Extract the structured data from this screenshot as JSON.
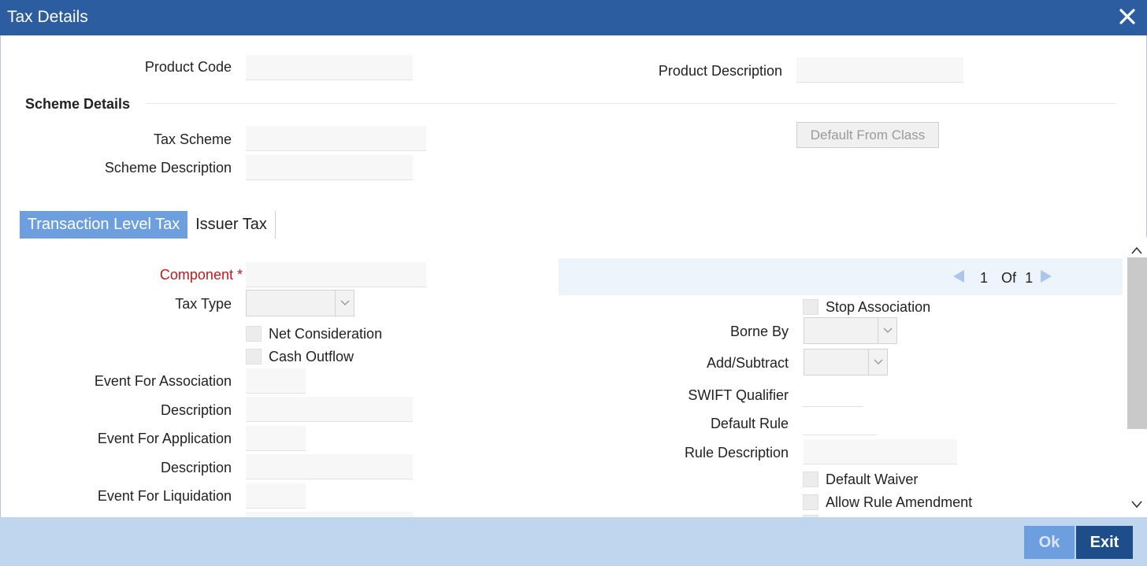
{
  "window": {
    "title": "Tax Details",
    "close_icon": "close-icon"
  },
  "header": {
    "product_code_label": "Product Code",
    "product_code_value": "",
    "product_description_label": "Product Description",
    "product_description_value": ""
  },
  "scheme": {
    "section_title": "Scheme Details",
    "tax_scheme_label": "Tax Scheme",
    "tax_scheme_value": "",
    "scheme_description_label": "Scheme Description",
    "scheme_description_value": "",
    "default_from_class_label": "Default From Class"
  },
  "tabs": [
    {
      "label": "Transaction Level Tax",
      "active": true
    },
    {
      "label": "Issuer Tax",
      "active": false
    }
  ],
  "left_form": {
    "component_label": "Component",
    "required_marker": "*",
    "tax_type_label": "Tax Type",
    "net_consideration_label": "Net Consideration",
    "cash_outflow_label": "Cash Outflow",
    "event_for_association_label": "Event For Association",
    "description_label": "Description",
    "event_for_application_label": "Event For Application",
    "event_for_liquidation_label": "Event For Liquidation"
  },
  "right_form": {
    "pager": {
      "current": "1",
      "of_label": "Of",
      "total": "1"
    },
    "stop_association_label": "Stop Association",
    "borne_by_label": "Borne By",
    "add_subtract_label": "Add/Subtract",
    "swift_qualifier_label": "SWIFT Qualifier",
    "default_rule_label": "Default Rule",
    "rule_description_label": "Rule Description",
    "default_waiver_label": "Default Waiver",
    "allow_rule_amendment_label": "Allow Rule Amendment"
  },
  "footer": {
    "ok_label": "Ok",
    "exit_label": "Exit"
  },
  "colors": {
    "titlebar": "#2c5da0",
    "tab_active": "#6d9ede",
    "footer": "#c0d6ee",
    "exit_button": "#1d4e8a",
    "required": "#c5161c"
  }
}
